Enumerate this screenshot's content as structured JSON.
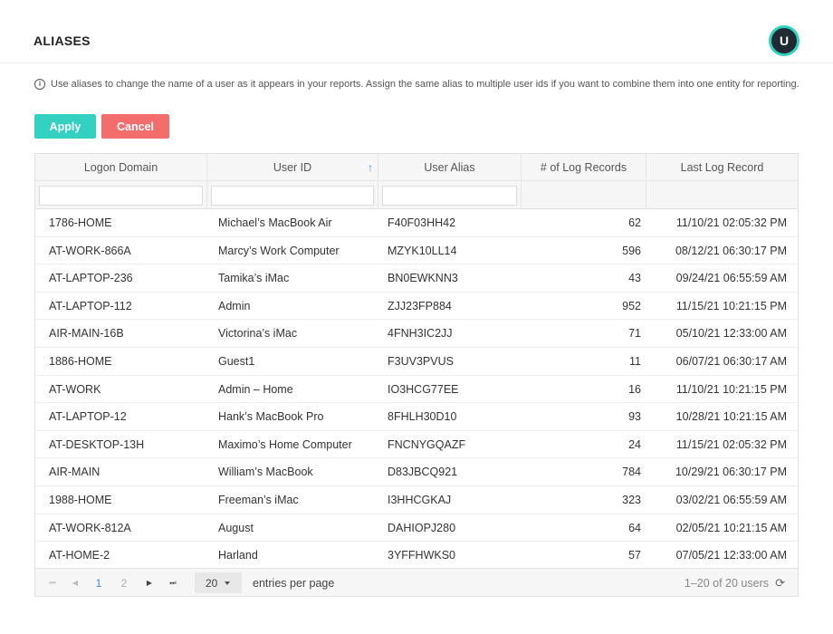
{
  "header": {
    "title": "ALIASES",
    "avatar_initial": "U"
  },
  "info": {
    "icon": "info-icon",
    "glyph": "i",
    "text": "Use aliases to change the name of a user as it appears in your reports. Assign the same alias to multiple user ids if you want to combine them into one entity for reporting."
  },
  "buttons": {
    "apply": "Apply",
    "cancel": "Cancel"
  },
  "colors": {
    "accent": "#33d1c1",
    "danger": "#f36d6d",
    "link": "#3a8ee6"
  },
  "table": {
    "columns": [
      "Logon Domain",
      "User ID",
      "User Alias",
      "# of Log Records",
      "Last Log Record"
    ],
    "sort": {
      "column": "User ID",
      "direction": "ascending",
      "icon": "arrow-up-icon",
      "glyph": "↑"
    },
    "filters": {
      "logon_domain": "",
      "user_id": "",
      "user_alias": ""
    },
    "rows": [
      [
        "1786-HOME",
        "Michael’s MacBook Air",
        "F40F03HH42",
        "62",
        "11/10/21 02:05:32 PM"
      ],
      [
        "AT-WORK-866A",
        "Marcy’s Work Computer",
        "MZYK10LL14",
        "596",
        "08/12/21 06:30:17 PM"
      ],
      [
        "AT-LAPTOP-236",
        "Tamika’s iMac",
        "BN0EWKNN3",
        "43",
        "09/24/21 06:55:59 AM"
      ],
      [
        "AT-LAPTOP-112",
        "Admin",
        "ZJJ23FP884",
        "952",
        "11/15/21 10:21:15 PM"
      ],
      [
        "AIR-MAIN-16B",
        "Victorina’s iMac",
        "4FNH3IC2JJ",
        "71",
        "05/10/21 12:33:00 AM"
      ],
      [
        "1886-HOME",
        "Guest1",
        "F3UV3PVUS",
        "11",
        "06/07/21 06:30:17 AM"
      ],
      [
        "AT-WORK",
        "Admin – Home",
        "IO3HCG77EE",
        "16",
        "11/10/21 10:21:15 PM"
      ],
      [
        "AT-LAPTOP-12",
        "Hank’s MacBook Pro",
        "8FHLH30D10",
        "93",
        "10/28/21 10:21:15 AM"
      ],
      [
        "AT-DESKTOP-13H",
        "Maximo’s Home Computer",
        "FNCNYGQAZF",
        "24",
        "11/15/21 02:05:32 PM"
      ],
      [
        "AIR-MAIN",
        "William’s MacBook",
        "D83JBCQ921",
        "784",
        "10/29/21 06:30:17 PM"
      ],
      [
        "1988-HOME",
        "Freeman’s iMac",
        "I3HHCGKAJ",
        "323",
        "03/02/21 06:55:59 AM"
      ],
      [
        "AT-WORK-812A",
        "August",
        "DAHIOPJ280",
        "64",
        "02/05/21 10:21:15 AM"
      ],
      [
        "AT-HOME-2",
        "Harland",
        "3YFFHWKS0",
        "57",
        "07/05/21 12:33:00 AM"
      ]
    ]
  },
  "pagination": {
    "nav_icons": {
      "first": "⏮",
      "prev": "◀",
      "next": "▶",
      "last": "⏭"
    },
    "pages": [
      "1",
      "2"
    ],
    "current_page": "1",
    "page_size": "20",
    "per_page_label": "entries per page",
    "range_text": "1–20 of 20 users",
    "refresh_icon": "refresh-icon",
    "refresh_glyph": "⟳"
  }
}
